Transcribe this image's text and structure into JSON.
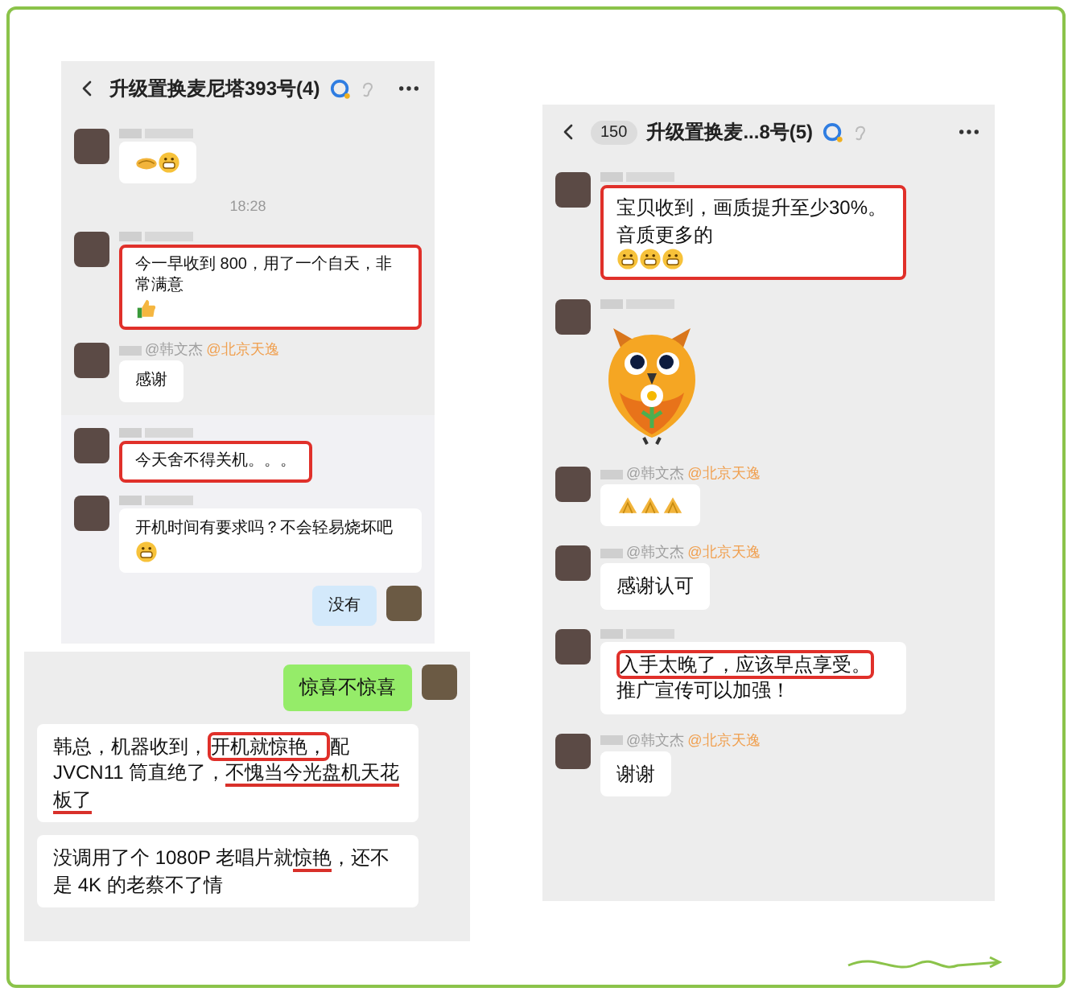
{
  "panels": [
    {
      "header": {
        "title": "升级置换麦尼塔393号(4)"
      },
      "messages": [
        {
          "kind": "in",
          "highlighted": false,
          "icons": [
            {
              "kind": "handshake"
            },
            {
              "kind": "grin"
            }
          ]
        },
        {
          "kind": "time",
          "text": "18:28"
        },
        {
          "kind": "in",
          "highlighted": true,
          "segments": [
            {
              "text": "今一早收到 800，用了一个自天，非常满意"
            }
          ],
          "icons": [
            {
              "kind": "thumb"
            }
          ]
        },
        {
          "kind": "in",
          "highlighted": false,
          "names": [
            {
              "text": "@韩文杰",
              "color": "#a0a0a0"
            },
            {
              "text": "@北京天逸",
              "color": "#f0a050"
            }
          ],
          "segments": [
            {
              "text": "感谢"
            }
          ]
        }
      ]
    },
    {
      "messages": [
        {
          "kind": "in",
          "highlighted": true,
          "segments": [
            {
              "text": "今天舍不得关机。。。"
            }
          ]
        },
        {
          "kind": "in",
          "highlighted": false,
          "segments": [
            {
              "text": "开机时间有要求吗？不会轻易烧坏吧"
            }
          ],
          "icons": [
            {
              "kind": "grin"
            }
          ]
        },
        {
          "kind": "out",
          "color": "#d3e9fb",
          "segments": [
            {
              "text": "没有"
            }
          ]
        }
      ]
    },
    {
      "messages": [
        {
          "kind": "out",
          "color": "#95ec69",
          "segments": [
            {
              "text": "惊喜不惊喜"
            }
          ]
        },
        {
          "kind": "plain",
          "highlighted": false,
          "segments": [
            {
              "text": "韩总，机器收到，"
            },
            {
              "text": "开机就惊艳，",
              "kind": "box"
            },
            {
              "text": "配 JVCN11 筒直绝了，"
            },
            {
              "text": "不愧当今光盘机天花板了",
              "kind": "underline"
            }
          ]
        },
        {
          "kind": "plain",
          "highlighted": false,
          "segments": [
            {
              "text": "没调用了个 1080P 老唱片就"
            },
            {
              "text": "惊艳",
              "kind": "underline"
            },
            {
              "text": "，还不是 4K 的老蔡不了情"
            }
          ]
        }
      ]
    },
    {
      "header": {
        "badge": "150",
        "title": "升级置换麦...8号(5)"
      },
      "messages": [
        {
          "kind": "in",
          "highlighted": true,
          "segments": [
            {
              "text": "宝贝收到，画质提升至少30%。音质更多的"
            }
          ],
          "icons": [
            {
              "kind": "grin"
            },
            {
              "kind": "grin"
            },
            {
              "kind": "grin"
            }
          ]
        },
        {
          "kind": "sticker"
        },
        {
          "kind": "in",
          "highlighted": false,
          "names": [
            {
              "text": "@韩文杰",
              "color": "#a0a0a0"
            },
            {
              "text": "@北京天逸",
              "color": "#f0a050"
            }
          ],
          "icons": [
            {
              "kind": "clap"
            },
            {
              "kind": "clap"
            },
            {
              "kind": "clap"
            }
          ]
        },
        {
          "kind": "in",
          "highlighted": false,
          "names": [
            {
              "text": "@韩文杰",
              "color": "#a0a0a0"
            },
            {
              "text": "@北京天逸",
              "color": "#f0a050"
            }
          ],
          "segments": [
            {
              "text": "感谢认可"
            }
          ]
        },
        {
          "kind": "in",
          "highlighted": false,
          "segments": [
            {
              "text": "入手太晚了，应该早点享受。",
              "kind": "box"
            },
            {
              "text": "推广宣传可以加强！"
            }
          ]
        },
        {
          "kind": "in",
          "highlighted": false,
          "names": [
            {
              "text": "@韩文杰",
              "color": "#a0a0a0"
            },
            {
              "text": "@北京天逸",
              "color": "#f0a050"
            }
          ],
          "segments": [
            {
              "text": "谢谢"
            }
          ]
        }
      ]
    }
  ]
}
